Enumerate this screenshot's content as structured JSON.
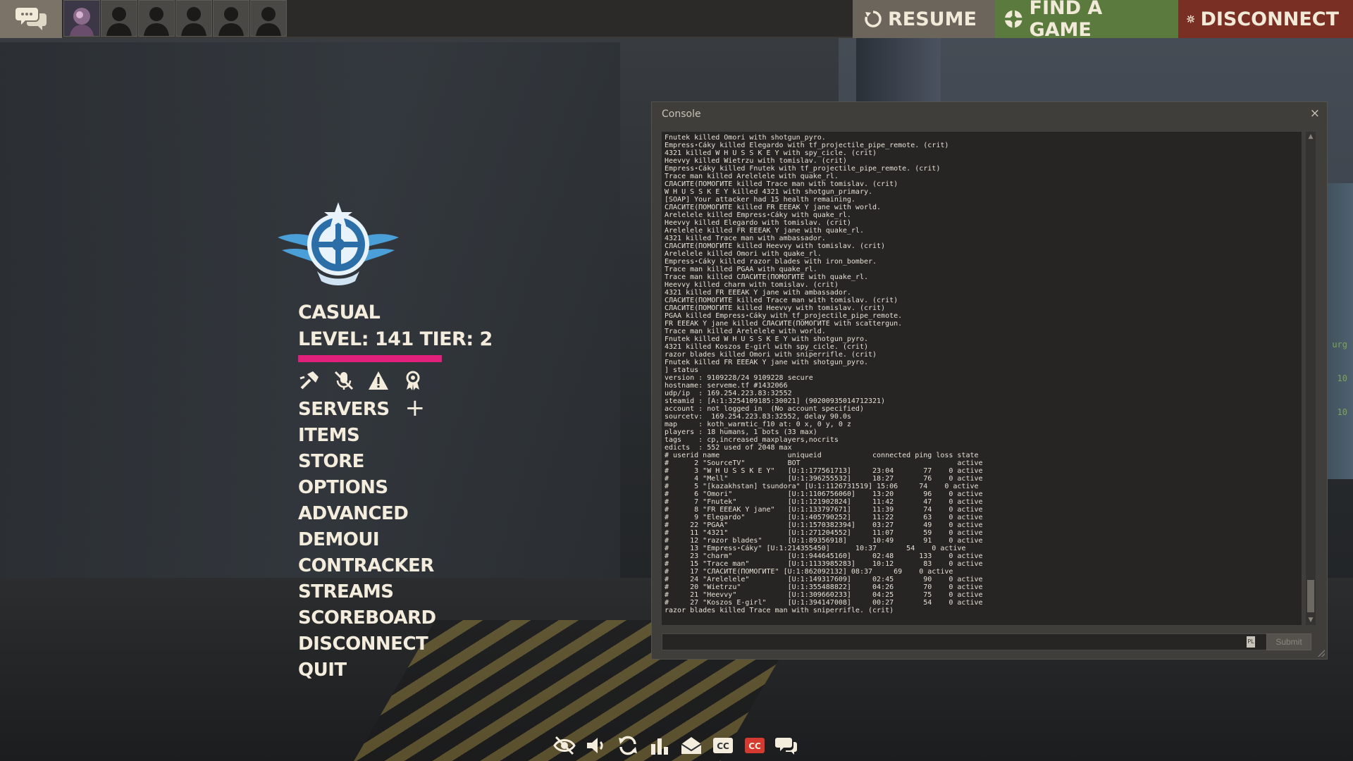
{
  "topbar": {
    "buttons": {
      "resume": "RESUME",
      "find_game": "FIND A GAME",
      "disconnect": "DISCONNECT"
    }
  },
  "main_menu": {
    "mode": "CASUAL",
    "level_text": "LEVEL: 141 TIER: 2",
    "level_bar_color": "#e0207a",
    "items": [
      "SERVERS",
      "ITEMS",
      "STORE",
      "OPTIONS",
      "ADVANCED",
      "DEMOUI",
      "CONTRACKER",
      "STREAMS",
      "SCOREBOARD",
      "DISCONNECT",
      "QUIT"
    ]
  },
  "console": {
    "title": "Console",
    "close": "×",
    "submit_label": "Submit",
    "input_lang": "PL",
    "output": [
      "Fnutek killed Omori with shotgun_pyro.",
      "Empress⋆Cáky killed Elegardo with tf_projectile_pipe_remote. (crit)",
      "4321 killed W H U S S K E Y with spy_cicle. (crit)",
      "Heevvy killed Wietrzu with tomislav. (crit)",
      "Empress⋆Cáky killed Fnutek with tf_projectile_pipe_remote. (crit)",
      "Trace man killed Arelelele with quake_rl.",
      "СЛАСИТЕ(ПОМОГИТЕ killed Trace man with tomislav. (crit)",
      "W H U S S K E Y killed 4321 with shotgun_primary.",
      "[SOAP] Your attacker had 15 health remaining.",
      "СЛАСИТЕ(ПОМОГИТЕ killed FR EEEAK Y jane with world.",
      "Arelelele killed Empress⋆Cáky with quake_rl.",
      "Heevvy killed Elegardo with tomislav. (crit)",
      "Arelelele killed FR EEEAK Y jane with quake_rl.",
      "4321 killed Trace man with ambassador.",
      "СЛАСИТЕ(ПОМОГИТЕ killed Heevvy with tomislav. (crit)",
      "Arelelele killed Omori with quake_rl.",
      "Empress⋆Cáky killed razor blades with iron_bomber.",
      "Trace man killed PGAA with quake_rl.",
      "Trace man killed СЛАСИТЕ(ПОМОГИТЕ with quake_rl.",
      "Heevvy killed charm with tomislav. (crit)",
      "4321 killed FR EEEAK Y jane with ambassador.",
      "СЛАСИТЕ(ПОМОГИТЕ killed Trace man with tomislav. (crit)",
      "СЛАСИТЕ(ПОМОГИТЕ killed Heevvy with tomislav. (crit)",
      "PGAA killed Empress⋆Cáky with tf_projectile_pipe_remote.",
      "FR EEEAK Y jane killed СЛАСИТЕ(ПОМОГИТЕ with scattergun.",
      "Trace man killed Arelelele with world.",
      "Fnutek killed W H U S S K E Y with shotgun_pyro.",
      "4321 killed Koszos E-girl with spy_cicle. (crit)",
      "razor blades killed Omori with sniperrifle. (crit)",
      "Fnutek killed FR EEEAK Y jane with shotgun_pyro.",
      "] status",
      "version : 9109228/24 9109228 secure",
      "hostname: serveme.tf #1432066",
      "udp/ip  : 169.254.223.83:32552",
      "steamid : [A:1:3254109185:30021] (90200935014712321)",
      "account : not logged in  (No account specified)",
      "sourcetv:  169.254.223.83:32552, delay 90.0s",
      "map     : koth_warmtic_f10 at: 0 x, 0 y, 0 z",
      "players : 18 humans, 1 bots (33 max)",
      "tags    : cp,increased_maxplayers,nocrits",
      "edicts  : 552 used of 2048 max",
      "# userid name                uniqueid            connected ping loss state",
      "#      2 \"SourceTV\"          BOT                                     active",
      "#      3 \"W H U S S K E Y\"   [U:1:177561713]     23:04       77    0 active",
      "#      4 \"Mell\"              [U:1:396255532]     18:27       76    0 active",
      "#      5 \"[kazakhstan] tsundora\" [U:1:1126731519] 15:06     74    0 active",
      "#      6 \"Omori\"             [U:1:1106756060]    13:20       96    0 active",
      "#      7 \"Fnutek\"            [U:1:121902824]     11:42       47    0 active",
      "#      8 \"FR EEEAK Y jane\"   [U:1:133797671]     11:39       74    0 active",
      "#      9 \"Elegardo\"          [U:1:405790252]     11:22       63    0 active",
      "#     22 \"PGAA\"              [U:1:1570382394]    03:27       49    0 active",
      "#     11 \"4321\"              [U:1:271204552]     11:07       59    0 active",
      "#     12 \"razor blades\"      [U:1:89356918]      10:49       91    0 active",
      "#     13 \"Empress⋆Cáky\" [U:1:214355450]      10:37       54    0 active",
      "#     23 \"charm\"             [U:1:944645160]     02:48      133    0 active",
      "#     15 \"Trace man\"         [U:1:1133985283]    10:12       83    0 active",
      "#     17 \"СЛАСИТЕ(ПОМОГИТЕ\" [U:1:862092132] 08:37     69    0 active",
      "#     24 \"Arelelele\"         [U:1:149317609]     02:45       90    0 active",
      "#     20 \"Wietrzu\"           [U:1:355488822]     04:26       70    0 active",
      "#     21 \"Heevvy\"            [U:1:309660233]     04:25       75    0 active",
      "#     27 \"Koszos E-girl\"     [U:1:394147008]     00:27       54    0 active",
      "razor blades killed Trace man with sniperrifle. (crit)"
    ]
  },
  "scene": {
    "side_text": [
      "urg",
      "10",
      "10"
    ]
  },
  "bottombar": {
    "icons": [
      "hidden-eye-icon",
      "speaker-icon",
      "refresh-icon",
      "bar-chart-icon",
      "mail-icon",
      "closed-captions-icon",
      "closed-captions-red-icon",
      "chat-bubbles-icon"
    ]
  }
}
